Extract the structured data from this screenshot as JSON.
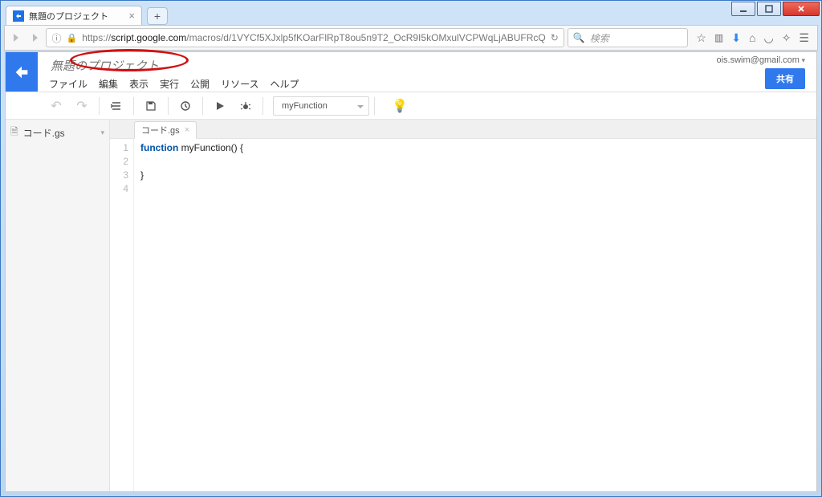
{
  "browser": {
    "tab_title": "無題のプロジェクト",
    "url_prefix": "https://",
    "url_domain": "script.google.com",
    "url_path": "/macros/d/1VYCf5XJxlp5fKOarFlRpT8ou5n9T2_OcR9I5kOMxulVCPWqLjABUFRcQ",
    "search_placeholder": "検索"
  },
  "app": {
    "project_name": "無題のプロジェクト",
    "menus": {
      "file": "ファイル",
      "edit": "編集",
      "view": "表示",
      "run": "実行",
      "publish": "公開",
      "resources": "リソース",
      "help": "ヘルプ"
    },
    "user_email": "ois.swim@gmail.com",
    "share_label": "共有",
    "selected_function": "myFunction",
    "sidebar_file": "コード.gs",
    "editor_tab": "コード.gs",
    "code": {
      "l1_kw": "function",
      "l1_rest": " myFunction() {",
      "l2": "  ",
      "l3": "}",
      "lineno1": "1",
      "lineno2": "2",
      "lineno3": "3",
      "lineno4": "4"
    }
  }
}
